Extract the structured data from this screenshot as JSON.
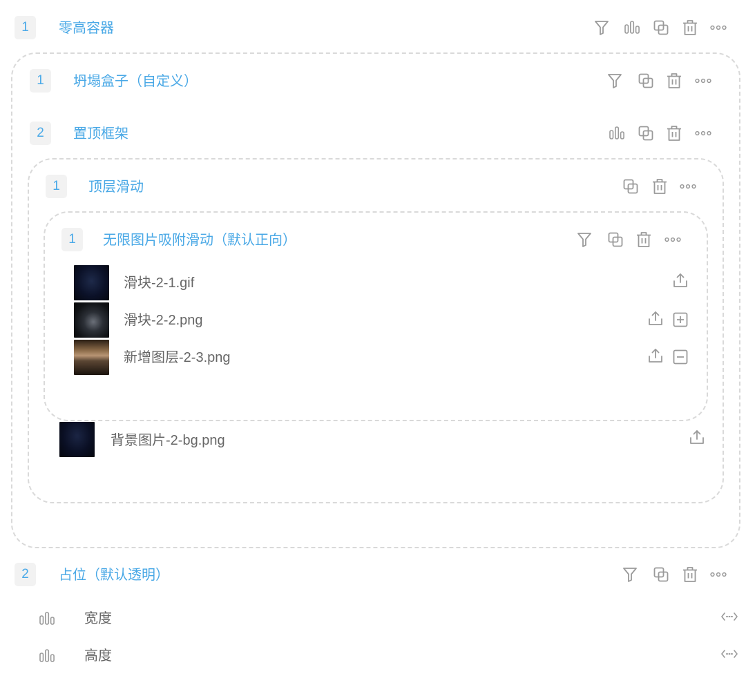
{
  "zero_container": {
    "index": "1",
    "title": "零高容器"
  },
  "collapse_box": {
    "index": "1",
    "title": "坍塌盒子（自定义）"
  },
  "pinned_frame": {
    "index": "2",
    "title": "置顶框架"
  },
  "top_scroll": {
    "index": "1",
    "title": "顶层滑动"
  },
  "infinite_scroll": {
    "index": "1",
    "title": "无限图片吸附滑动（默认正向）",
    "images": [
      {
        "name": "滑块-2-1.gif"
      },
      {
        "name": "滑块-2-2.png"
      },
      {
        "name": "新增图层-2-3.png"
      }
    ]
  },
  "background_image": {
    "name": "背景图片-2-bg.png"
  },
  "placeholder": {
    "index": "2",
    "title": "占位（默认透明）"
  },
  "properties": [
    {
      "label": "宽度"
    },
    {
      "label": "高度"
    }
  ],
  "colors": {
    "accent": "#49a8e6",
    "icon": "#9a9a9a",
    "dashed_border": "#d9d9d9",
    "badge_bg": "#f2f2f2"
  }
}
